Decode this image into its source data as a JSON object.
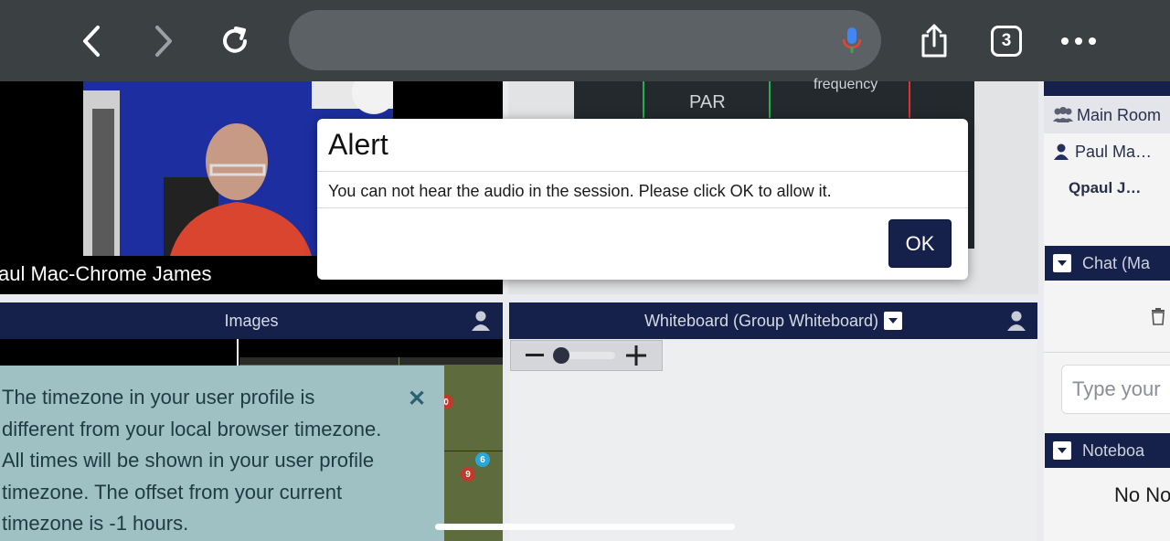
{
  "browser": {
    "tab_count": "3"
  },
  "video": {
    "participant_name": "aul Mac-Chrome James"
  },
  "stats": {
    "par_label": "PAR",
    "frequency_label": "frequency"
  },
  "sidebar": {
    "main_room": "Main Room",
    "user_name": "Paul Ma…",
    "sub_user": "Qpaul J…",
    "chat_title": "Chat (Ma",
    "chat_placeholder": "Type your",
    "notebook_title": "Noteboa",
    "notebook_empty": "No No"
  },
  "images_panel": {
    "title": "Images"
  },
  "whiteboard_panel": {
    "title": "Whiteboard (Group Whiteboard)"
  },
  "timezone_notice": {
    "text": "The timezone in your user profile is different from your local browser timezone. All times will be shown in your user profile timezone. The offset from your current timezone is -1 hours."
  },
  "map_markers": [
    "0",
    "6",
    "9"
  ],
  "alert": {
    "title": "Alert",
    "message": "You can not hear the audio in the session. Please click OK to allow it.",
    "ok_label": "OK"
  },
  "colors": {
    "navy": "#15214a",
    "toolbar": "#3b4043",
    "toast": "#9fc1c4"
  }
}
